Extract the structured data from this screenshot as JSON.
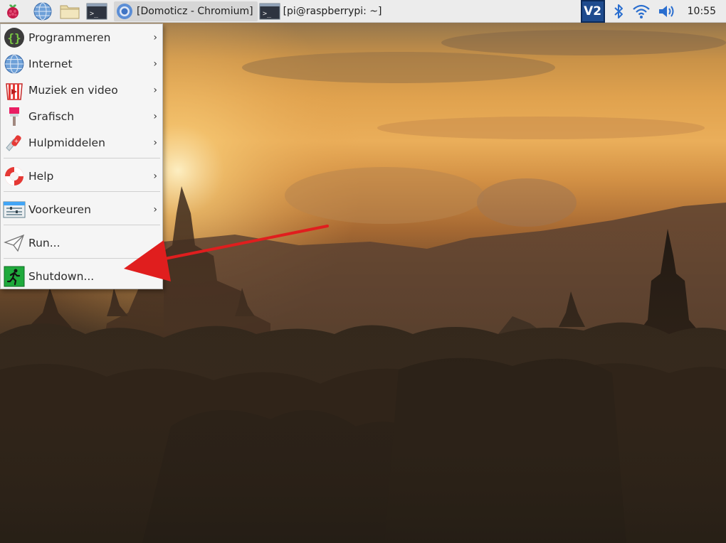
{
  "taskbar": {
    "launcher_icon": "raspberry-icon",
    "quick_launch": [
      "globe-icon",
      "folder-icon",
      "terminal-icon"
    ],
    "tasks": [
      {
        "label": "[Domoticz - Chromium]",
        "icon": "chromium-icon",
        "active": true
      },
      {
        "label": "[pi@raspberrypi: ~]",
        "icon": "terminal-icon",
        "active": false
      }
    ],
    "tray": {
      "vnc_label": "V2",
      "icons": [
        "bluetooth-icon",
        "wifi-icon",
        "volume-icon"
      ],
      "clock": "10:55"
    }
  },
  "menu": {
    "items": [
      {
        "label": "Programmeren",
        "icon": "programming-icon",
        "submenu": true
      },
      {
        "label": "Internet",
        "icon": "globe-icon",
        "submenu": true
      },
      {
        "label": "Muziek en video",
        "icon": "media-icon",
        "submenu": true
      },
      {
        "label": "Grafisch",
        "icon": "graphics-brush-icon",
        "submenu": true
      },
      {
        "label": "Hulpmiddelen",
        "icon": "accessories-knife-icon",
        "submenu": true
      },
      {
        "label": "Help",
        "icon": "lifebuoy-icon",
        "submenu": true
      },
      {
        "label": "Voorkeuren",
        "icon": "preferences-icon",
        "submenu": true
      },
      {
        "label": "Run...",
        "icon": "paper-plane-icon",
        "submenu": false
      },
      {
        "label": "Shutdown...",
        "icon": "exit-running-man-icon",
        "submenu": false
      }
    ],
    "submenu_arrow": "›"
  },
  "colors": {
    "annotation_arrow": "#e01e1e",
    "panel_bg": "#ececec",
    "menu_bg": "#f5f5f5"
  }
}
